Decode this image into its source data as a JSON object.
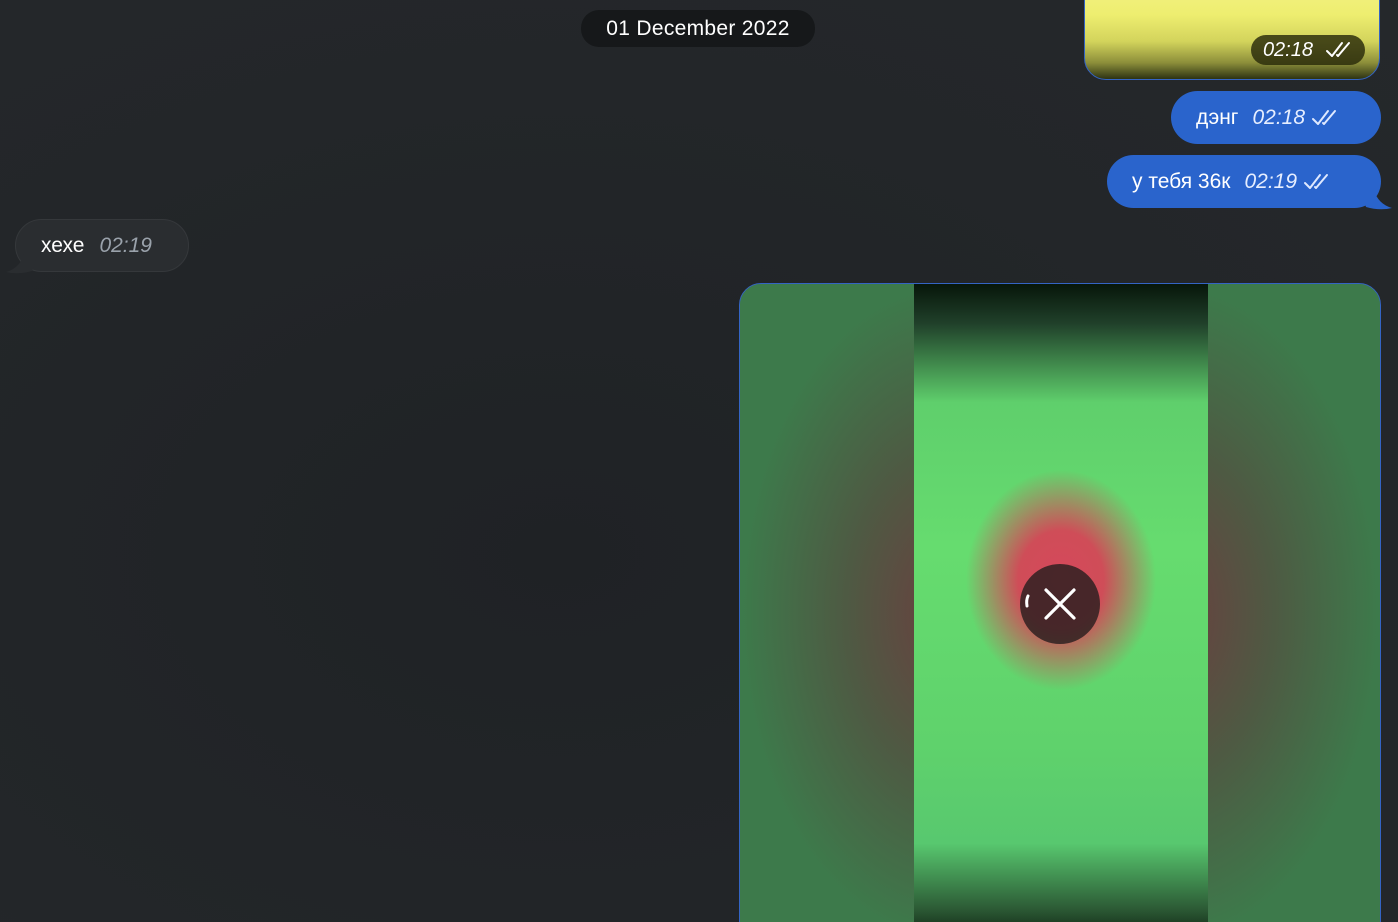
{
  "date_separator": "01 December 2022",
  "messages": [
    {
      "type": "media",
      "direction": "out",
      "time": "02:18",
      "status": "read",
      "color": "#eeee70"
    },
    {
      "type": "text",
      "direction": "out",
      "text": "дэнг",
      "time": "02:18",
      "status": "read"
    },
    {
      "type": "text",
      "direction": "out",
      "text": "у тебя 36к",
      "time": "02:19",
      "status": "read"
    },
    {
      "type": "text",
      "direction": "in",
      "text": "хехе",
      "time": "02:19"
    },
    {
      "type": "video",
      "direction": "out",
      "state": "uploading",
      "cancel_icon": "close-icon"
    }
  ],
  "colors": {
    "background": "#222528",
    "outgoing_bubble": "#2a64cc",
    "incoming_bubble": "#2a2d30",
    "date_pill": "#16181a"
  },
  "icons": {
    "read_status": "double-check-icon",
    "cancel_upload": "close-icon",
    "upload_progress": "progress-ring-icon"
  }
}
